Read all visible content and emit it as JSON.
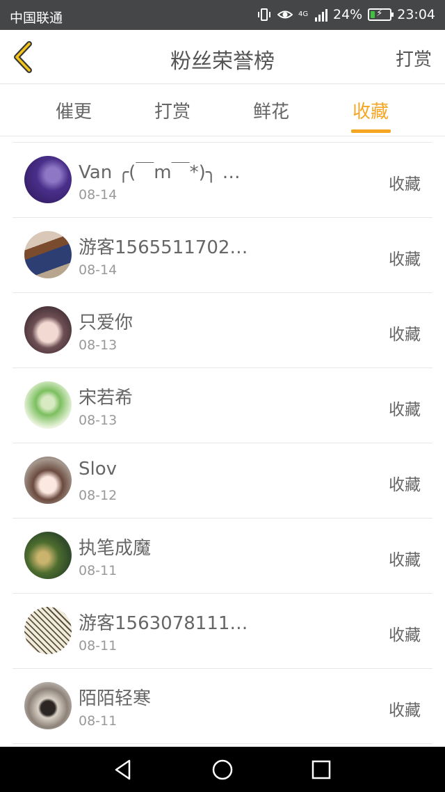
{
  "status_bar": {
    "carrier": "中国联通",
    "network": "4G",
    "battery": "24%",
    "time": "23:04",
    "battery_level": 0.24,
    "colors": {
      "background": "#444648",
      "battery": "#3ec33e"
    }
  },
  "header": {
    "back_icon": "chevron-left-icon",
    "title": "粉丝荣誉榜",
    "reward_label": "打赏"
  },
  "tabs": [
    {
      "label": "催更",
      "active": false
    },
    {
      "label": "打赏",
      "active": false
    },
    {
      "label": "鲜花",
      "active": false
    },
    {
      "label": "收藏",
      "active": true
    }
  ],
  "accent_color": "#f5a623",
  "list": [
    {
      "name": "Van ╭(￣m￣*)╮ …",
      "date": "08-14",
      "action": "收藏"
    },
    {
      "name": "游客1565511702…",
      "date": "08-14",
      "action": "收藏"
    },
    {
      "name": "只爱你",
      "date": "08-13",
      "action": "收藏"
    },
    {
      "name": "宋若希",
      "date": "08-13",
      "action": "收藏"
    },
    {
      "name": "Slov",
      "date": "08-12",
      "action": "收藏"
    },
    {
      "name": "执笔成魔",
      "date": "08-11",
      "action": "收藏"
    },
    {
      "name": "游客1563078111…",
      "date": "08-11",
      "action": "收藏"
    },
    {
      "name": "陌陌轻寒",
      "date": "08-11",
      "action": "收藏"
    }
  ],
  "nav_bar": {
    "back_icon": "triangle-back-icon",
    "home_icon": "circle-home-icon",
    "recents_icon": "square-recents-icon"
  }
}
